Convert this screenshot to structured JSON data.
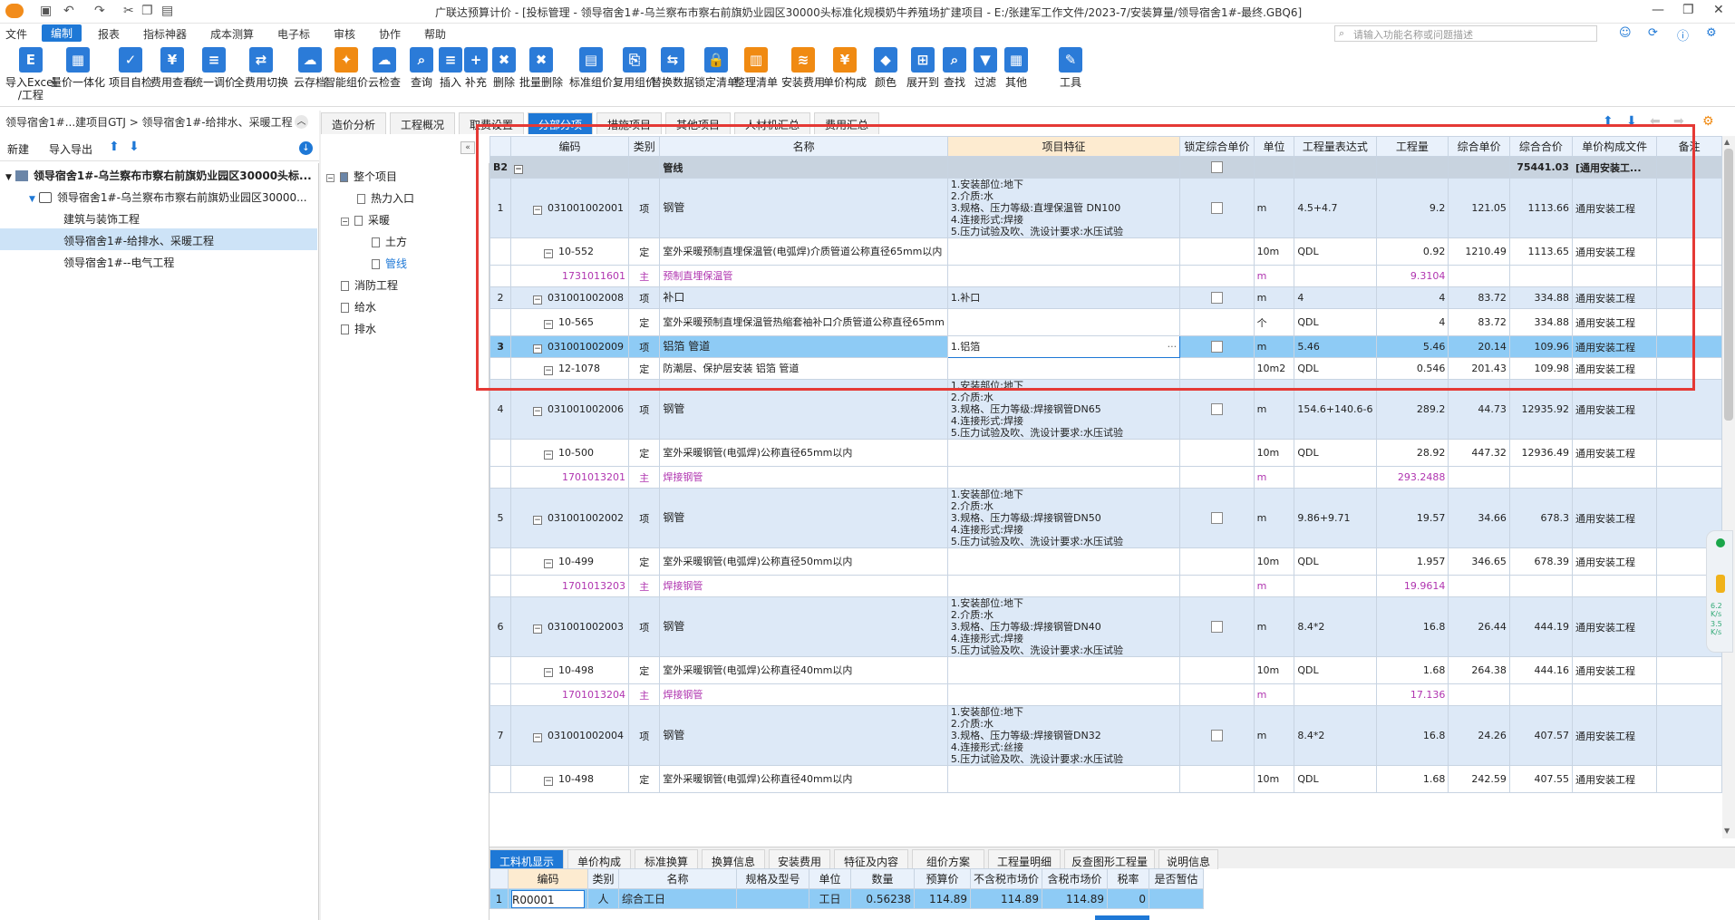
{
  "window": {
    "title": "广联达预算计价 - [投标管理 - 领导宿舍1#-乌兰察布市察右前旗奶业园区30000头标准化规模奶牛养殖场扩建项目 - E:/张建军工作文件/2023-7/安装算量/领导宿舍1#-最终.GBQ6]",
    "search_placeholder": "请输入功能名称或问题描述"
  },
  "menu": [
    "文件",
    "编制",
    "报表",
    "指标神器",
    "成本测算",
    "电子标",
    "审核",
    "协作",
    "帮助"
  ],
  "ribbon": [
    {
      "label": "导入Excel",
      "label2": "/工程",
      "icon": "excel-import-icon",
      "color": "#2b7bd8",
      "glyph": "E"
    },
    {
      "label": "量价一体化",
      "icon": "integration-icon",
      "color": "#2b7bd8",
      "glyph": "▦"
    },
    {
      "label": "项目自检",
      "icon": "self-check-icon",
      "color": "#2b7bd8",
      "glyph": "✓"
    },
    {
      "label": "费用查看",
      "icon": "fee-view-icon",
      "color": "#2b7bd8",
      "glyph": "¥"
    },
    {
      "label": "统一调价",
      "icon": "adjust-price-icon",
      "color": "#2b7bd8",
      "glyph": "≡"
    },
    {
      "label": "全费用切换",
      "icon": "full-fee-icon",
      "color": "#2b7bd8",
      "glyph": "⇄"
    },
    {
      "label": "云存档",
      "icon": "cloud-save-icon",
      "color": "#2b7bd8",
      "glyph": "☁"
    },
    {
      "label": "智能组价",
      "icon": "smart-price-icon",
      "color": "#f08a12",
      "glyph": "✦"
    },
    {
      "label": "云检查",
      "icon": "cloud-check-icon",
      "color": "#2b7bd8",
      "glyph": "☁"
    },
    {
      "label": "查询",
      "icon": "query-icon",
      "color": "#2b7bd8",
      "glyph": "⌕"
    },
    {
      "label": "插入",
      "icon": "insert-icon",
      "color": "#2b7bd8",
      "glyph": "≡"
    },
    {
      "label": "补充",
      "icon": "supplement-icon",
      "color": "#2b7bd8",
      "glyph": "+"
    },
    {
      "label": "删除",
      "icon": "delete-icon",
      "color": "#2b7bd8",
      "glyph": "✖"
    },
    {
      "label": "批量删除",
      "icon": "batch-delete-icon",
      "color": "#2b7bd8",
      "glyph": "✖"
    },
    {
      "label": "标准组价",
      "icon": "standard-price-icon",
      "color": "#2b7bd8",
      "glyph": "▤"
    },
    {
      "label": "复用组价",
      "icon": "reuse-price-icon",
      "color": "#2b7bd8",
      "glyph": "⎘"
    },
    {
      "label": "替换数据",
      "icon": "replace-data-icon",
      "color": "#2b7bd8",
      "glyph": "⇆"
    },
    {
      "label": "锁定清单",
      "icon": "lock-list-icon",
      "color": "#2b7bd8",
      "glyph": "🔒"
    },
    {
      "label": "整理清单",
      "icon": "organize-list-icon",
      "color": "#f08a12",
      "glyph": "▥"
    },
    {
      "label": "安装费用",
      "icon": "install-fee-icon",
      "color": "#f08a12",
      "glyph": "≋"
    },
    {
      "label": "单价构成",
      "icon": "unit-price-icon",
      "color": "#f08a12",
      "glyph": "¥"
    },
    {
      "label": "颜色",
      "icon": "color-icon",
      "color": "#2b7bd8",
      "glyph": "◆"
    },
    {
      "label": "展开到",
      "icon": "expand-to-icon",
      "color": "#2b7bd8",
      "glyph": "⊞"
    },
    {
      "label": "查找",
      "icon": "find-icon",
      "color": "#2b7bd8",
      "glyph": "⌕"
    },
    {
      "label": "过滤",
      "icon": "filter-icon",
      "color": "#2b7bd8",
      "glyph": "▼"
    },
    {
      "label": "其他",
      "icon": "other-icon",
      "color": "#2b7bd8",
      "glyph": "▦"
    },
    {
      "label": "工具",
      "icon": "tools-icon",
      "color": "#2b7bd8",
      "glyph": "✎"
    }
  ],
  "breadcrumb": "领导宿舍1#...建项目GTJ > 领导宿舍1#-给排水、采暖工程",
  "left_toolbar": {
    "new": "新建",
    "import_export": "导入导出"
  },
  "project_tree": [
    {
      "label": "领导宿舍1#-乌兰察布市察右前旗奶业园区30000头标...",
      "icon": "building-icon"
    },
    {
      "label": "领导宿舍1#-乌兰察布市察右前旗奶业园区30000...",
      "icon": "home-icon"
    },
    {
      "label": "建筑与装饰工程"
    },
    {
      "label": "领导宿舍1#-给排水、采暖工程"
    },
    {
      "label": "领导宿舍1#--电气工程"
    }
  ],
  "main_tabs": [
    "造价分析",
    "工程概况",
    "取费设置",
    "分部分项",
    "措施项目",
    "其他项目",
    "人材机汇总",
    "费用汇总"
  ],
  "division_tree": {
    "root": "整个项目",
    "items": [
      "热力入口",
      "采暖",
      "土方",
      "管线",
      "消防工程",
      "给水",
      "排水"
    ]
  },
  "grid": {
    "headers": [
      "",
      "编码",
      "类别",
      "名称",
      "项目特征",
      "锁定综合单价",
      "单位",
      "工程量表达式",
      "工程量",
      "综合单价",
      "综合合价",
      "单价构成文件",
      "备注"
    ],
    "section": {
      "code": "B2",
      "name": "管线",
      "total": "75441.03",
      "file": "[通用安装工..."
    },
    "rows": [
      {
        "type": "q",
        "no": "1",
        "code": "031001002001",
        "cat": "项",
        "name": "钢管",
        "feat": "1.安装部位:地下\n2.介质:水\n3.规格、压力等级:直埋保温管  DN100\n4.连接形式:焊接\n5.压力试验及吹、洗设计要求:水压试验",
        "unit": "m",
        "expr": "4.5+4.7",
        "qty": "9.2",
        "price": "121.05",
        "total": "1113.66",
        "file": "通用安装工程"
      },
      {
        "type": "d",
        "code": "10-552",
        "cat": "定",
        "name": "室外采暖预制直埋保温管(电弧焊)介质管道公称直径65mm以内",
        "feat": "",
        "unit": "10m",
        "expr": "QDL",
        "qty": "0.92",
        "price": "1210.49",
        "total": "1113.65",
        "file": "通用安装工程"
      },
      {
        "type": "m",
        "code": "1731011601",
        "cat": "主",
        "name": "预制直埋保温管",
        "feat": "",
        "unit": "m",
        "expr": "",
        "qty": "9.3104",
        "price": "",
        "total": "",
        "file": ""
      },
      {
        "type": "q",
        "no": "2",
        "code": "031001002008",
        "cat": "项",
        "name": "补口",
        "feat": "1.补口",
        "unit": "m",
        "expr": "4",
        "qty": "4",
        "price": "83.72",
        "total": "334.88",
        "file": "通用安装工程"
      },
      {
        "type": "d",
        "code": "10-565",
        "cat": "定",
        "name": "室外采暖预制直埋保温管热缩套袖补口介质管道公称直径65mm",
        "feat": "",
        "unit": "个",
        "expr": "QDL",
        "qty": "4",
        "price": "83.72",
        "total": "334.88",
        "file": "通用安装工程"
      },
      {
        "type": "sel",
        "no": "3",
        "code": "031001002009",
        "cat": "项",
        "name": "铝箔 管道",
        "feat": "1.铝箔",
        "unit": "m",
        "expr": "5.46",
        "qty": "5.46",
        "price": "20.14",
        "total": "109.96",
        "file": "通用安装工程"
      },
      {
        "type": "d",
        "code": "12-1078",
        "cat": "定",
        "name": "防潮层、保护层安装 铝箔 管道",
        "feat": "",
        "unit": "10m2",
        "expr": "QDL",
        "qty": "0.546",
        "price": "201.43",
        "total": "109.98",
        "file": "通用安装工程"
      },
      {
        "type": "q",
        "no": "4",
        "code": "031001002006",
        "cat": "项",
        "name": "钢管",
        "feat": "1.安装部位:地下\n2.介质:水\n3.规格、压力等级:焊接钢管DN65\n4.连接形式:焊接\n5.压力试验及吹、洗设计要求:水压试验",
        "unit": "m",
        "expr": "154.6+140.6-6",
        "qty": "289.2",
        "price": "44.73",
        "total": "12935.92",
        "file": "通用安装工程"
      },
      {
        "type": "d",
        "code": "10-500",
        "cat": "定",
        "name": "室外采暖钢管(电弧焊)公称直径65mm以内",
        "feat": "",
        "unit": "10m",
        "expr": "QDL",
        "qty": "28.92",
        "price": "447.32",
        "total": "12936.49",
        "file": "通用安装工程"
      },
      {
        "type": "m",
        "code": "1701013201",
        "cat": "主",
        "name": "焊接钢管",
        "feat": "",
        "unit": "m",
        "expr": "",
        "qty": "293.2488",
        "price": "",
        "total": "",
        "file": ""
      },
      {
        "type": "q",
        "no": "5",
        "code": "031001002002",
        "cat": "项",
        "name": "钢管",
        "feat": "1.安装部位:地下\n2.介质:水\n3.规格、压力等级:焊接钢管DN50\n4.连接形式:焊接\n5.压力试验及吹、洗设计要求:水压试验",
        "unit": "m",
        "expr": "9.86+9.71",
        "qty": "19.57",
        "price": "34.66",
        "total": "678.3",
        "file": "通用安装工程"
      },
      {
        "type": "d",
        "code": "10-499",
        "cat": "定",
        "name": "室外采暖钢管(电弧焊)公称直径50mm以内",
        "feat": "",
        "unit": "10m",
        "expr": "QDL",
        "qty": "1.957",
        "price": "346.65",
        "total": "678.39",
        "file": "通用安装工程"
      },
      {
        "type": "m",
        "code": "1701013203",
        "cat": "主",
        "name": "焊接钢管",
        "feat": "",
        "unit": "m",
        "expr": "",
        "qty": "19.9614",
        "price": "",
        "total": "",
        "file": ""
      },
      {
        "type": "q",
        "no": "6",
        "code": "031001002003",
        "cat": "项",
        "name": "钢管",
        "feat": "1.安装部位:地下\n2.介质:水\n3.规格、压力等级:焊接钢管DN40\n4.连接形式:焊接\n5.压力试验及吹、洗设计要求:水压试验",
        "unit": "m",
        "expr": "8.4*2",
        "qty": "16.8",
        "price": "26.44",
        "total": "444.19",
        "file": "通用安装工程"
      },
      {
        "type": "d",
        "code": "10-498",
        "cat": "定",
        "name": "室外采暖钢管(电弧焊)公称直径40mm以内",
        "feat": "",
        "unit": "10m",
        "expr": "QDL",
        "qty": "1.68",
        "price": "264.38",
        "total": "444.16",
        "file": "通用安装工程"
      },
      {
        "type": "m",
        "code": "1701013204",
        "cat": "主",
        "name": "焊接钢管",
        "feat": "",
        "unit": "m",
        "expr": "",
        "qty": "17.136",
        "price": "",
        "total": "",
        "file": ""
      },
      {
        "type": "q",
        "no": "7",
        "code": "031001002004",
        "cat": "项",
        "name": "钢管",
        "feat": "1.安装部位:地下\n2.介质:水\n3.规格、压力等级:焊接钢管DN32\n4.连接形式:丝接\n5.压力试验及吹、洗设计要求:水压试验",
        "unit": "m",
        "expr": "8.4*2",
        "qty": "16.8",
        "price": "24.26",
        "total": "407.57",
        "file": "通用安装工程"
      },
      {
        "type": "d",
        "code": "10-498",
        "cat": "定",
        "name": "室外采暖钢管(电弧焊)公称直径40mm以内",
        "feat": "",
        "unit": "10m",
        "expr": "QDL",
        "qty": "1.68",
        "price": "242.59",
        "total": "407.55",
        "file": "通用安装工程"
      }
    ]
  },
  "bottom_tabs": [
    "工料机显示",
    "单价构成",
    "标准换算",
    "换算信息",
    "安装费用",
    "特征及内容",
    "组价方案",
    "工程量明细",
    "反查图形工程量",
    "说明信息"
  ],
  "bottom_grid": {
    "headers": [
      "",
      "编码",
      "类别",
      "名称",
      "规格及型号",
      "单位",
      "数量",
      "预算价",
      "不含税市场价",
      "含税市场价",
      "税率",
      "是否暂估"
    ],
    "rows": [
      {
        "no": "1",
        "code": "R00001",
        "cat": "人",
        "name": "综合工日",
        "spec": "",
        "unit": "工日",
        "qty": "0.56238",
        "budget": "114.89",
        "mkt": "114.89",
        "mkt_tax": "114.89",
        "tax": "0",
        "est": ""
      }
    ]
  },
  "side_widget": {
    "up": "6.2",
    "up_unit": "K/s",
    "down": "3.5",
    "down_unit": "K/s"
  },
  "colors": {
    "accent": "#1e78d6",
    "selected_row": "#8ecbf5",
    "list_row": "#dde9f7",
    "highlight_box": "#e53935",
    "material_text": "#b035b0"
  }
}
